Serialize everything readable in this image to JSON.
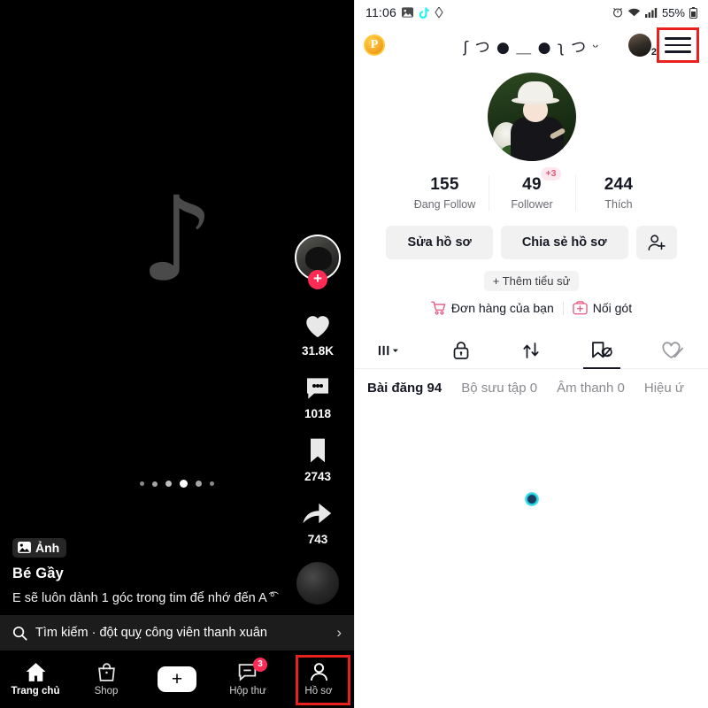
{
  "feed": {
    "watermark": "♪",
    "rail": {
      "avatar_plus": "+",
      "like_count": "31.8K",
      "comment_count": "1018",
      "bookmark_count": "2743",
      "share_count": "743"
    },
    "carousel": {
      "total": 6,
      "active_index": 3
    },
    "photo_badge": "Ảnh",
    "author": "Bé Gầy",
    "caption": "E sẽ luôn dành 1 góc trong tim để nhớ đến A ͡°",
    "search": {
      "text": "Tìm kiếm · đột quỵ công viên thanh xuân",
      "chevron": "›"
    },
    "bottom_nav": [
      {
        "label": "Trang chủ",
        "icon": "home-icon"
      },
      {
        "label": "Shop",
        "icon": "shop-bag-icon"
      },
      {
        "label": "",
        "icon": "create-plus-icon"
      },
      {
        "label": "Hộp thư",
        "icon": "inbox-icon",
        "badge": "3"
      },
      {
        "label": "Hồ sơ",
        "icon": "person-icon"
      }
    ]
  },
  "profile": {
    "statusbar": {
      "time": "11:06",
      "battery": "55%"
    },
    "header": {
      "coin_label": "P",
      "username": "ʃ つ ● ＿ ● ʅ つ ᵕ",
      "mini_avatar_count": "2"
    },
    "stats": [
      {
        "num": "155",
        "label": "Đang Follow"
      },
      {
        "num": "49",
        "label": "Follower",
        "badge": "+3"
      },
      {
        "num": "244",
        "label": "Thích"
      }
    ],
    "actions": {
      "edit_profile": "Sửa hồ sơ",
      "share_profile": "Chia sẻ hồ sơ",
      "add_friend_icon": "person-add-icon"
    },
    "add_bio": "+ Thêm tiểu sử",
    "links": [
      {
        "label": "Đơn hàng của bạn",
        "icon": "cart-icon"
      },
      {
        "label": "Nối gót",
        "icon": "add-box-icon"
      }
    ],
    "tab_icons": [
      {
        "name": "grid-dropdown-icon",
        "active": false
      },
      {
        "name": "lock-icon",
        "active": false
      },
      {
        "name": "repost-icon",
        "active": false
      },
      {
        "name": "bookmark-hidden-icon",
        "active": true
      },
      {
        "name": "heart-hidden-icon",
        "active": false
      }
    ],
    "sub_tabs": [
      {
        "label": "Bài đăng 94",
        "active": true
      },
      {
        "label": "Bộ sưu tập 0",
        "active": false
      },
      {
        "label": "Âm thanh 0",
        "active": false
      },
      {
        "label": "Hiệu ứ",
        "active": false
      }
    ]
  },
  "colors": {
    "accent_pink": "#fe2c55",
    "highlight_red": "#e8211f",
    "cyan": "#25f4ee",
    "coin_orange": "#f5a623"
  }
}
